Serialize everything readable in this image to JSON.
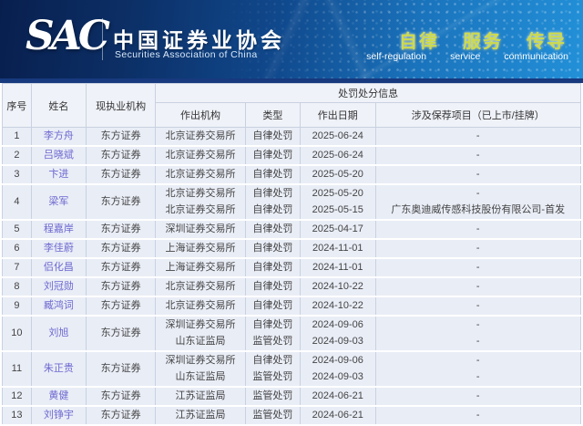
{
  "banner": {
    "logo": "SAC",
    "org_zh": "中国证券业协会",
    "org_en": "Securities Association of China",
    "slogans": [
      {
        "zh": "自律",
        "en": "self-regulation"
      },
      {
        "zh": "服务",
        "en": "service"
      },
      {
        "zh": "传导",
        "en": "communication"
      }
    ]
  },
  "table": {
    "group_header": "处罚处分信息",
    "columns": {
      "no": "序号",
      "name": "姓名",
      "org": "现执业机构",
      "agency": "作出机构",
      "type": "类型",
      "date": "作出日期",
      "project": "涉及保荐项目（已上市/挂牌）"
    },
    "rows": [
      {
        "no": "1",
        "name": "李方舟",
        "org": "东方证券",
        "penalties": [
          {
            "agency": "北京证券交易所",
            "type": "自律处罚",
            "date": "2025-06-24",
            "project": "-"
          }
        ]
      },
      {
        "no": "2",
        "name": "吕晓斌",
        "org": "东方证券",
        "penalties": [
          {
            "agency": "北京证券交易所",
            "type": "自律处罚",
            "date": "2025-06-24",
            "project": "-"
          }
        ]
      },
      {
        "no": "3",
        "name": "卞进",
        "org": "东方证券",
        "penalties": [
          {
            "agency": "北京证券交易所",
            "type": "自律处罚",
            "date": "2025-05-20",
            "project": "-"
          }
        ]
      },
      {
        "no": "4",
        "name": "梁军",
        "org": "东方证券",
        "penalties": [
          {
            "agency": "北京证券交易所",
            "type": "自律处罚",
            "date": "2025-05-20",
            "project": "-"
          },
          {
            "agency": "北京证券交易所",
            "type": "自律处罚",
            "date": "2025-05-15",
            "project": "广东奥迪威传感科技股份有限公司-首发"
          }
        ]
      },
      {
        "no": "5",
        "name": "程嘉岸",
        "org": "东方证券",
        "penalties": [
          {
            "agency": "深圳证券交易所",
            "type": "自律处罚",
            "date": "2025-04-17",
            "project": "-"
          }
        ]
      },
      {
        "no": "6",
        "name": "李佳蔚",
        "org": "东方证券",
        "penalties": [
          {
            "agency": "上海证券交易所",
            "type": "自律处罚",
            "date": "2024-11-01",
            "project": "-"
          }
        ]
      },
      {
        "no": "7",
        "name": "侣化昌",
        "org": "东方证券",
        "penalties": [
          {
            "agency": "上海证券交易所",
            "type": "自律处罚",
            "date": "2024-11-01",
            "project": "-"
          }
        ]
      },
      {
        "no": "8",
        "name": "刘冠勋",
        "org": "东方证券",
        "penalties": [
          {
            "agency": "北京证券交易所",
            "type": "自律处罚",
            "date": "2024-10-22",
            "project": "-"
          }
        ]
      },
      {
        "no": "9",
        "name": "臧鸿词",
        "org": "东方证券",
        "penalties": [
          {
            "agency": "北京证券交易所",
            "type": "自律处罚",
            "date": "2024-10-22",
            "project": "-"
          }
        ]
      },
      {
        "no": "10",
        "name": "刘旭",
        "org": "东方证券",
        "penalties": [
          {
            "agency": "深圳证券交易所",
            "type": "自律处罚",
            "date": "2024-09-06",
            "project": "-"
          },
          {
            "agency": "山东证监局",
            "type": "监管处罚",
            "date": "2024-09-03",
            "project": "-"
          }
        ]
      },
      {
        "no": "11",
        "name": "朱正贵",
        "org": "东方证券",
        "penalties": [
          {
            "agency": "深圳证券交易所",
            "type": "自律处罚",
            "date": "2024-09-06",
            "project": "-"
          },
          {
            "agency": "山东证监局",
            "type": "监管处罚",
            "date": "2024-09-03",
            "project": "-"
          }
        ]
      },
      {
        "no": "12",
        "name": "黄健",
        "org": "东方证券",
        "penalties": [
          {
            "agency": "江苏证监局",
            "type": "监管处罚",
            "date": "2024-06-21",
            "project": "-"
          }
        ]
      },
      {
        "no": "13",
        "name": "刘铮宇",
        "org": "东方证券",
        "penalties": [
          {
            "agency": "江苏证监局",
            "type": "监管处罚",
            "date": "2024-06-21",
            "project": "-"
          }
        ]
      }
    ]
  },
  "colors": {
    "banner_navy": "#0c2f66",
    "banner_blue": "#2290d8",
    "divider_bar": "#17397e",
    "slogan_green": "#cdda4d",
    "header_bg": "#eff2f8",
    "row_bg": "#e9edf6",
    "cell_border": "#c9d1e1",
    "link": "#6e68d0"
  }
}
